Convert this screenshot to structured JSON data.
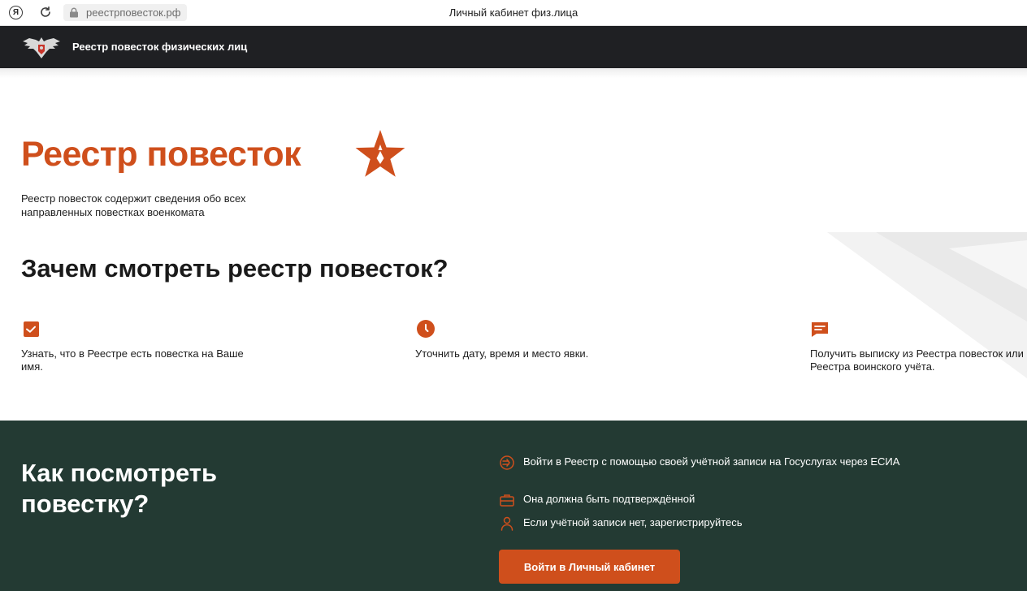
{
  "browser": {
    "url": "реестрповесток.рф",
    "tab_title": "Личный кабинет физ.лица",
    "yandex_glyph": "Я",
    "icons": [
      "yandex-icon",
      "reload-icon",
      "lock-icon"
    ]
  },
  "header": {
    "brand": "Реестр повесток физических лиц",
    "emblem_icon": "double-headed-eagle-emblem"
  },
  "hero": {
    "title": "Реестр повесток",
    "description": "Реестр повесток содержит сведения обо всех направленных повестках военкомата",
    "star_icon": "army-star-icon"
  },
  "why": {
    "title": "Зачем смотреть реестр повесток?",
    "features": [
      {
        "icon": "mail-check-icon",
        "text": "Узнать, что в Реестре есть повестка на Ваше имя."
      },
      {
        "icon": "clock-icon",
        "text": "Уточнить дату, время и место явки."
      },
      {
        "icon": "message-icon",
        "text": "Получить выписку из Реестра повесток или Реестра воинского учёта."
      }
    ]
  },
  "how": {
    "title": "Как посмотреть повестку?",
    "steps": [
      {
        "icon": "login-icon",
        "text": "Войти в Реестр с помощью своей учётной записи на Госуслугах через ЕСИА"
      },
      {
        "icon": "briefcase-icon",
        "text": "Она должна быть подтверждённой"
      },
      {
        "icon": "person-icon",
        "text": "Если учётной записи нет, зарегистрируйтесь"
      }
    ],
    "cta_label": "Войти в Личный кабинет"
  },
  "colors": {
    "accent": "#cf4f1c",
    "header_bg": "#1f2023",
    "dark_section_bg": "#233a33"
  }
}
